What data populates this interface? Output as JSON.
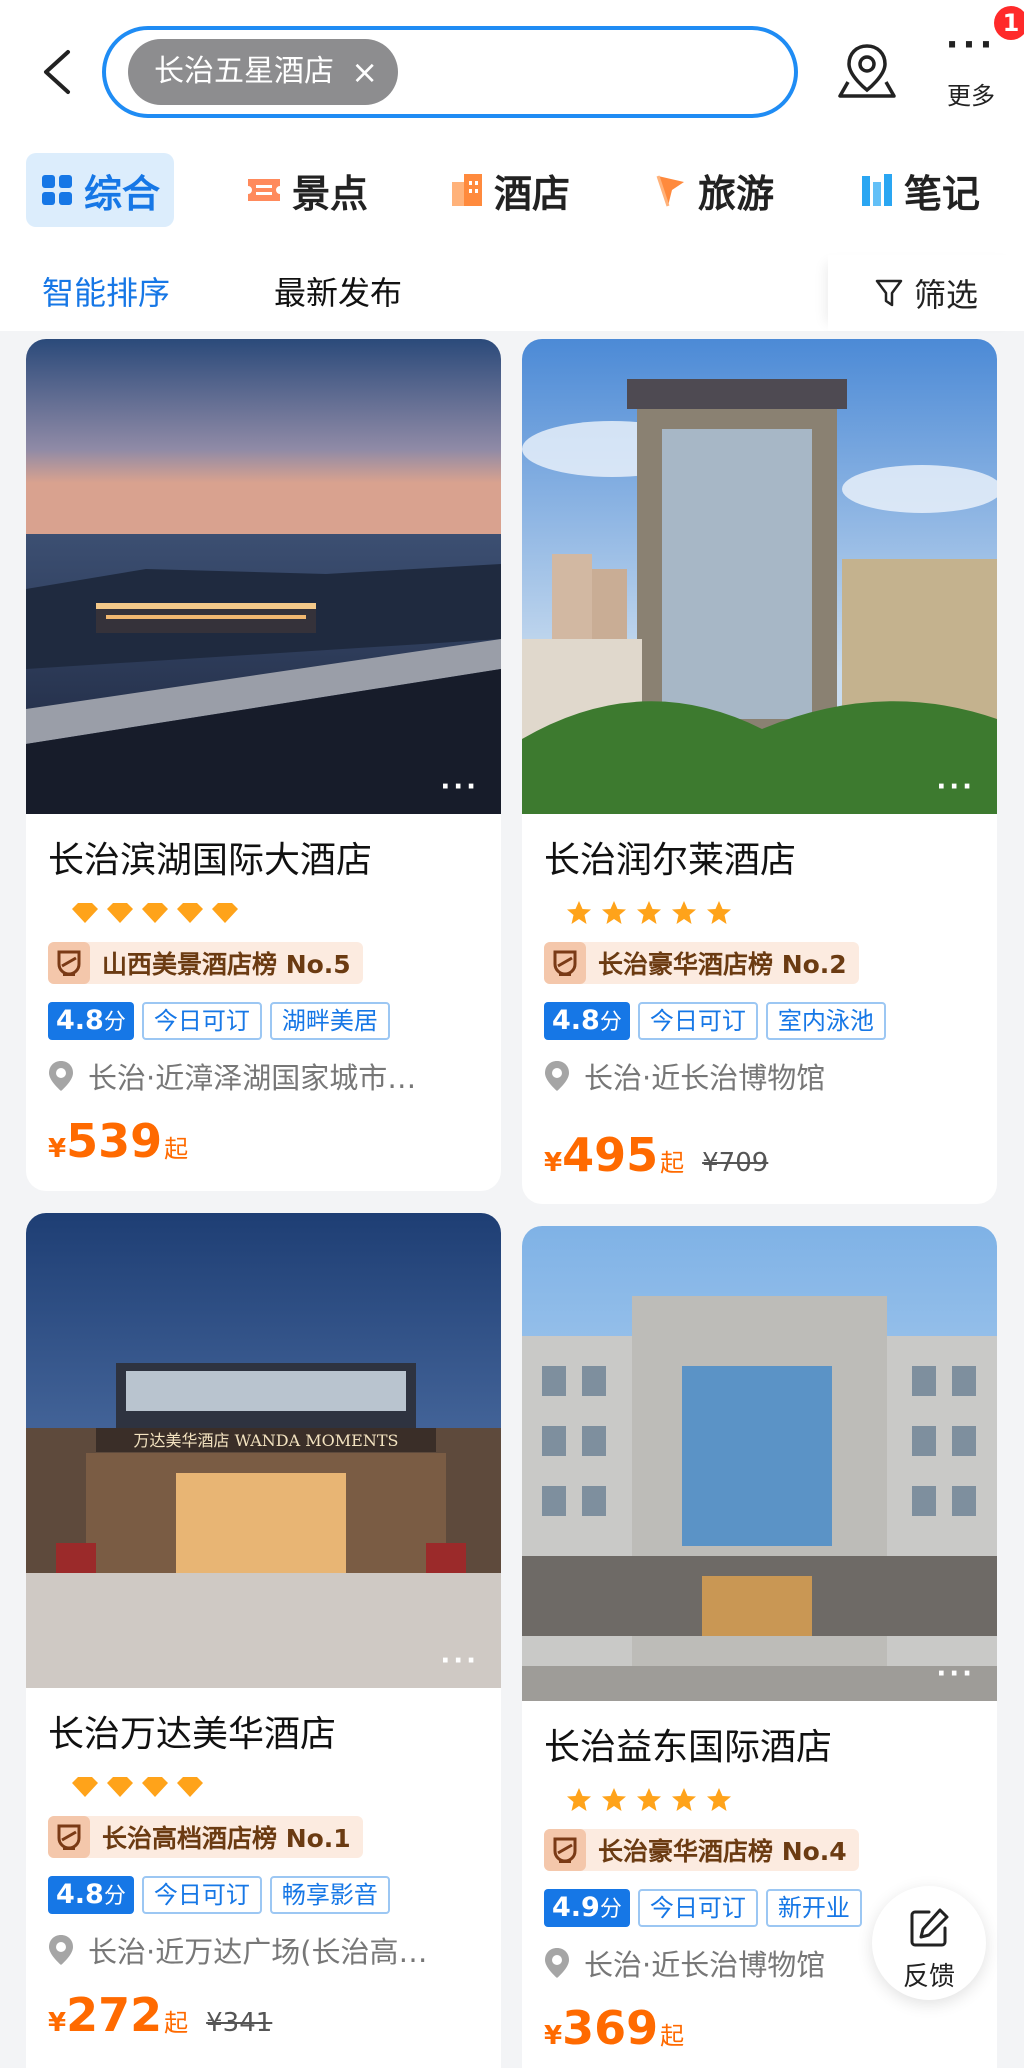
{
  "search": {
    "chip_text": "长治五星酒店",
    "chip_close": "×"
  },
  "header": {
    "more_label": "更多",
    "more_dots": "···",
    "notification_count": "1"
  },
  "tabs": [
    {
      "label": "综合",
      "icon": "grid-icon",
      "active": true
    },
    {
      "label": "景点",
      "icon": "ticket-icon"
    },
    {
      "label": "酒店",
      "icon": "building-icon"
    },
    {
      "label": "旅游",
      "icon": "flag-icon"
    },
    {
      "label": "笔记",
      "icon": "notes-icon"
    }
  ],
  "sort": {
    "smart": "智能排序",
    "latest": "最新发布",
    "filter": "筛选"
  },
  "hotels": [
    {
      "name": "长治滨湖国际大酒店",
      "diamonds": 5,
      "rank": "山西美景酒店榜 No.5",
      "score": "4.8",
      "score_unit": "分",
      "tags": [
        "今日可订",
        "湖畔美居"
      ],
      "location": "长治·近漳泽湖国家城市…",
      "currency": "¥",
      "price": "539",
      "price_suffix": "起",
      "original_price": ""
    },
    {
      "name": "长治润尔莱酒店",
      "stars": 5,
      "rank": "长治豪华酒店榜 No.2",
      "score": "4.8",
      "score_unit": "分",
      "tags": [
        "今日可订",
        "室内泳池"
      ],
      "location": "长治·近长治博物馆",
      "currency": "¥",
      "price": "495",
      "price_suffix": "起",
      "original_price": "¥709"
    },
    {
      "name": "长治万达美华酒店",
      "diamonds": 4,
      "rank": "长治高档酒店榜 No.1",
      "score": "4.8",
      "score_unit": "分",
      "tags": [
        "今日可订",
        "畅享影音"
      ],
      "location": "长治·近万达广场(长治高…",
      "currency": "¥",
      "price": "272",
      "price_suffix": "起",
      "original_price": "¥341",
      "photo_sign": "万达美华酒店 WANDA MOMENTS"
    },
    {
      "name": "长治益东国际酒店",
      "stars": 5,
      "rank": "长治豪华酒店榜 No.4",
      "score": "4.9",
      "score_unit": "分",
      "tags": [
        "今日可订",
        "新开业"
      ],
      "location": "长治·近长治博物馆",
      "currency": "¥",
      "price": "369",
      "price_suffix": "起",
      "original_price": ""
    }
  ],
  "feedback": {
    "label": "反馈"
  },
  "colors": {
    "accent": "#1677e6",
    "price": "#ff6a00",
    "star": "#ffa31a",
    "badge": "#ff2a2a"
  }
}
